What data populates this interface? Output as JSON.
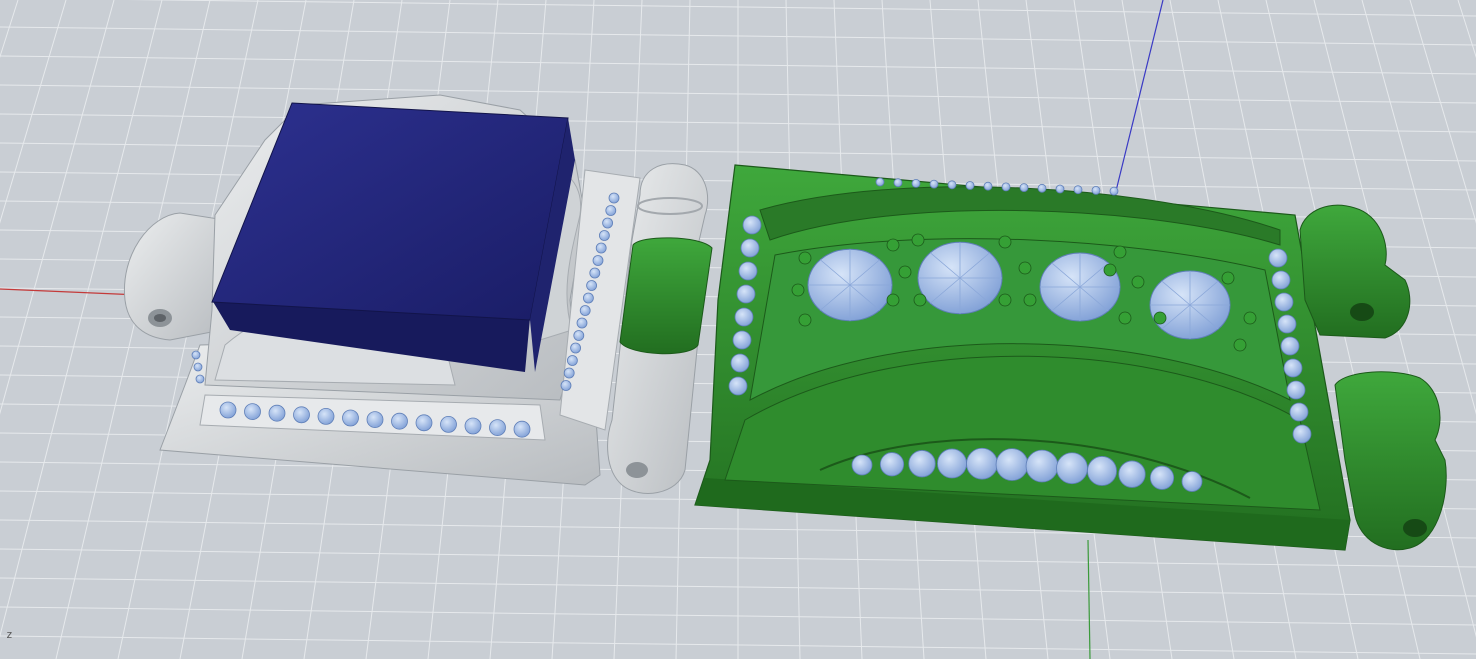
{
  "viewport": {
    "axis_indicator": "z",
    "background_color": "#c9ced4",
    "grid_line_color": "#e6e9ec",
    "axes": {
      "x_color": "#c43a3a",
      "y_color": "#3a9a3a",
      "z_color": "#3a3ac4"
    }
  },
  "models": [
    {
      "name": "silver-clasp-part",
      "material_color": "#d6d8da",
      "top_color": "#262a7c",
      "gem_color": "#9ab8e6"
    },
    {
      "name": "green-clasp-part",
      "material_color": "#2e8a2c",
      "gem_color": "#9ab8e6"
    }
  ]
}
